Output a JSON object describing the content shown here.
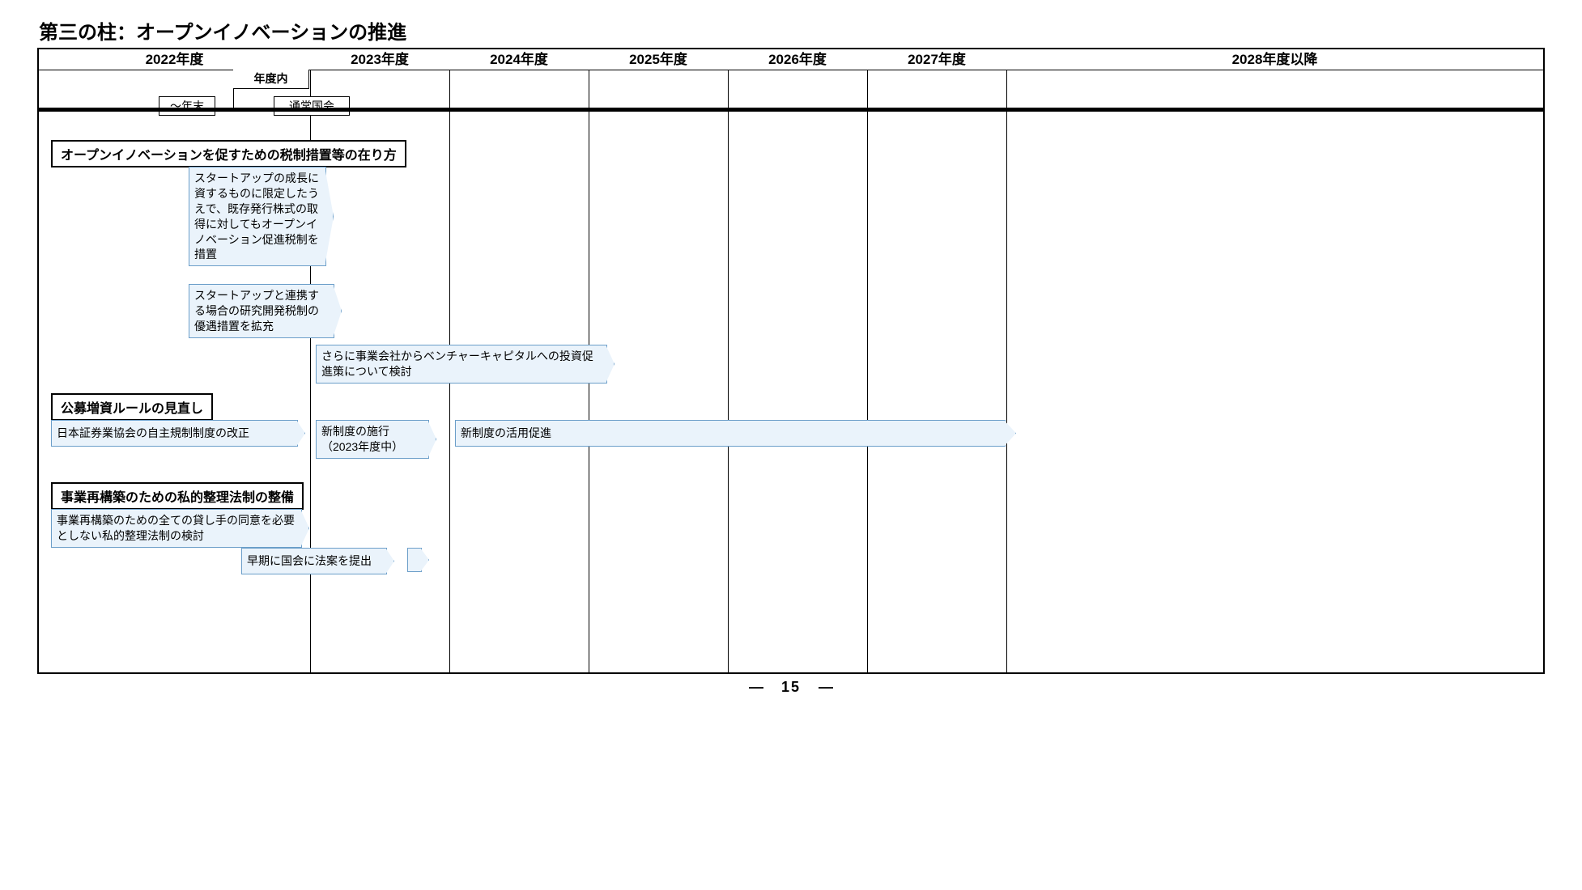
{
  "title": "第三の柱：オープンイノベーションの推進",
  "columns": [
    "2022年度",
    "2023年度",
    "2024年度",
    "2025年度",
    "2026年度",
    "2027年度",
    "2028年度以降"
  ],
  "subhead": {
    "inYear": "年度内",
    "byYearEnd": "～年末",
    "diet": "通常国会"
  },
  "sections": {
    "s1": {
      "title": "オープンイノベーションを促すための税制措置等の在り方",
      "items": [
        "スタートアップの成長に資するものに限定したうえで、既存発行株式の取得に対してもオープンイノベーション促進税制を措置",
        "スタートアップと連携する場合の研究開発税制の優遇措置を拡充",
        "さらに事業会社からベンチャーキャピタルへの投資促進策について検討"
      ]
    },
    "s2": {
      "title": "公募増資ルールの見直し",
      "items": [
        "日本証券業協会の自主規制制度の改正",
        "新制度の施行（2023年度中）",
        "新制度の活用促進"
      ]
    },
    "s3": {
      "title": "事業再構築のための私的整理法制の整備",
      "items": [
        "事業再構築のための全ての貸し手の同意を必要としない私的整理法制の検討",
        "早期に国会に法案を提出"
      ]
    }
  },
  "pageNumber": "15"
}
